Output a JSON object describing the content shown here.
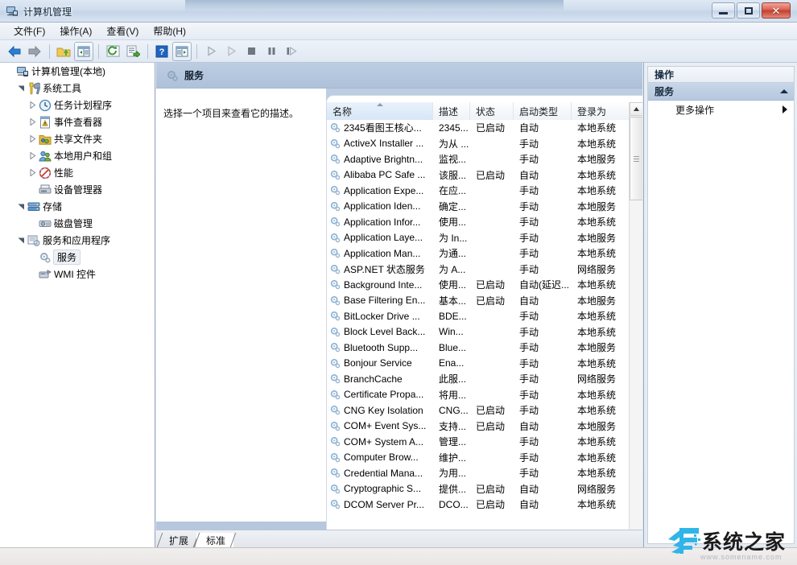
{
  "window": {
    "title": "计算机管理",
    "app_icon": "computer-management-icon",
    "buttons": {
      "minimize": "–",
      "maximize": "□",
      "close": "✕"
    }
  },
  "menubar": {
    "items": [
      {
        "label": "文件(F)",
        "name": "menu-file"
      },
      {
        "label": "操作(A)",
        "name": "menu-action"
      },
      {
        "label": "查看(V)",
        "name": "menu-view"
      },
      {
        "label": "帮助(H)",
        "name": "menu-help"
      }
    ]
  },
  "toolbar": {
    "items": [
      {
        "name": "back-icon",
        "title": "后退"
      },
      {
        "name": "forward-icon",
        "title": "前进"
      },
      {
        "name": "up-folder-icon",
        "title": "上移一级"
      },
      {
        "name": "show-hide-tree-icon",
        "title": "显示/隐藏控制台树"
      },
      {
        "name": "refresh-icon",
        "title": "刷新"
      },
      {
        "name": "export-list-icon",
        "title": "导出列表"
      },
      {
        "name": "help-icon",
        "title": "帮助"
      },
      {
        "name": "show-action-pane-icon",
        "title": "显示/隐藏操作窗格"
      },
      {
        "name": "start-service-icon",
        "title": "启动服务"
      },
      {
        "name": "resume-service-icon",
        "title": "恢复服务"
      },
      {
        "name": "stop-service-icon",
        "title": "停止服务"
      },
      {
        "name": "pause-service-icon",
        "title": "暂停服务"
      },
      {
        "name": "restart-service-icon",
        "title": "重启服务"
      }
    ]
  },
  "tree": {
    "root": {
      "label": "计算机管理(本地)",
      "icon": "computer-icon",
      "level": 0,
      "arrow": "none"
    },
    "items": [
      {
        "label": "系统工具",
        "icon": "system-tools-icon",
        "level": 1,
        "arrow": "expanded"
      },
      {
        "label": "任务计划程序",
        "icon": "task-scheduler-icon",
        "level": 2,
        "arrow": "collapsed"
      },
      {
        "label": "事件查看器",
        "icon": "event-viewer-icon",
        "level": 2,
        "arrow": "collapsed"
      },
      {
        "label": "共享文件夹",
        "icon": "shared-folders-icon",
        "level": 2,
        "arrow": "collapsed"
      },
      {
        "label": "本地用户和组",
        "icon": "local-users-icon",
        "level": 2,
        "arrow": "collapsed"
      },
      {
        "label": "性能",
        "icon": "performance-icon",
        "level": 2,
        "arrow": "collapsed"
      },
      {
        "label": "设备管理器",
        "icon": "device-manager-icon",
        "level": 2,
        "arrow": "none"
      },
      {
        "label": "存储",
        "icon": "storage-icon",
        "level": 1,
        "arrow": "expanded"
      },
      {
        "label": "磁盘管理",
        "icon": "disk-management-icon",
        "level": 2,
        "arrow": "none"
      },
      {
        "label": "服务和应用程序",
        "icon": "services-apps-icon",
        "level": 1,
        "arrow": "expanded"
      },
      {
        "label": "服务",
        "icon": "service-gear-icon",
        "level": 2,
        "arrow": "none",
        "selected": true
      },
      {
        "label": "WMI 控件",
        "icon": "wmi-control-icon",
        "level": 2,
        "arrow": "none"
      }
    ]
  },
  "content": {
    "header": {
      "title": "服务",
      "icon": "service-gear-icon"
    },
    "detail_text": "选择一个项目来查看它的描述。",
    "columns": [
      {
        "label": "名称",
        "key": "name",
        "sorted": true,
        "sort_dir": "asc"
      },
      {
        "label": "描述",
        "key": "desc",
        "sorted": false
      },
      {
        "label": "状态",
        "key": "status",
        "sorted": false
      },
      {
        "label": "启动类型",
        "key": "start",
        "sorted": false
      },
      {
        "label": "登录为",
        "key": "logon",
        "sorted": false
      }
    ],
    "rows": [
      {
        "name": "2345看图王核心...",
        "desc": "2345...",
        "status": "已启动",
        "start": "自动",
        "logon": "本地系统"
      },
      {
        "name": "ActiveX Installer ...",
        "desc": "为从 ...",
        "status": "",
        "start": "手动",
        "logon": "本地系统"
      },
      {
        "name": "Adaptive Brightn...",
        "desc": "监视...",
        "status": "",
        "start": "手动",
        "logon": "本地服务"
      },
      {
        "name": "Alibaba PC Safe ...",
        "desc": "该服...",
        "status": "已启动",
        "start": "自动",
        "logon": "本地系统"
      },
      {
        "name": "Application Expe...",
        "desc": "在应...",
        "status": "",
        "start": "手动",
        "logon": "本地系统"
      },
      {
        "name": "Application Iden...",
        "desc": "确定...",
        "status": "",
        "start": "手动",
        "logon": "本地服务"
      },
      {
        "name": "Application Infor...",
        "desc": "使用...",
        "status": "",
        "start": "手动",
        "logon": "本地系统"
      },
      {
        "name": "Application Laye...",
        "desc": "为 In...",
        "status": "",
        "start": "手动",
        "logon": "本地服务"
      },
      {
        "name": "Application Man...",
        "desc": "为通...",
        "status": "",
        "start": "手动",
        "logon": "本地系统"
      },
      {
        "name": "ASP.NET 状态服务",
        "desc": "为 A...",
        "status": "",
        "start": "手动",
        "logon": "网络服务"
      },
      {
        "name": "Background Inte...",
        "desc": "使用...",
        "status": "已启动",
        "start": "自动(延迟...",
        "logon": "本地系统"
      },
      {
        "name": "Base Filtering En...",
        "desc": "基本...",
        "status": "已启动",
        "start": "自动",
        "logon": "本地服务"
      },
      {
        "name": "BitLocker Drive ...",
        "desc": "BDE...",
        "status": "",
        "start": "手动",
        "logon": "本地系统"
      },
      {
        "name": "Block Level Back...",
        "desc": "Win...",
        "status": "",
        "start": "手动",
        "logon": "本地系统"
      },
      {
        "name": "Bluetooth Supp...",
        "desc": "Blue...",
        "status": "",
        "start": "手动",
        "logon": "本地服务"
      },
      {
        "name": "Bonjour Service",
        "desc": "Ena...",
        "status": "",
        "start": "手动",
        "logon": "本地系统"
      },
      {
        "name": "BranchCache",
        "desc": "此服...",
        "status": "",
        "start": "手动",
        "logon": "网络服务"
      },
      {
        "name": "Certificate Propa...",
        "desc": "将用...",
        "status": "",
        "start": "手动",
        "logon": "本地系统"
      },
      {
        "name": "CNG Key Isolation",
        "desc": "CNG...",
        "status": "已启动",
        "start": "手动",
        "logon": "本地系统"
      },
      {
        "name": "COM+ Event Sys...",
        "desc": "支持...",
        "status": "已启动",
        "start": "自动",
        "logon": "本地服务"
      },
      {
        "name": "COM+ System A...",
        "desc": "管理...",
        "status": "",
        "start": "手动",
        "logon": "本地系统"
      },
      {
        "name": "Computer Brow...",
        "desc": "维护...",
        "status": "",
        "start": "手动",
        "logon": "本地系统"
      },
      {
        "name": "Credential Mana...",
        "desc": "为用...",
        "status": "",
        "start": "手动",
        "logon": "本地系统"
      },
      {
        "name": "Cryptographic S...",
        "desc": "提供...",
        "status": "已启动",
        "start": "自动",
        "logon": "网络服务"
      },
      {
        "name": "DCOM Server Pr...",
        "desc": "DCO...",
        "status": "已启动",
        "start": "自动",
        "logon": "本地系统"
      }
    ],
    "tabs": [
      {
        "label": "扩展",
        "active": false
      },
      {
        "label": "标准",
        "active": true
      }
    ]
  },
  "actions": {
    "title": "操作",
    "group_label": "服务",
    "items": [
      {
        "label": "更多操作",
        "arrow": "submenu"
      }
    ]
  },
  "watermark": {
    "text": "系统之家",
    "url": "www.somename.com"
  },
  "colors": {
    "titlebar_text": "#0b2239",
    "header_band": "#b6c7de",
    "accent": "#2e7dd1",
    "close_red": "#c13f2e",
    "tree_bg": "#ffffff"
  }
}
